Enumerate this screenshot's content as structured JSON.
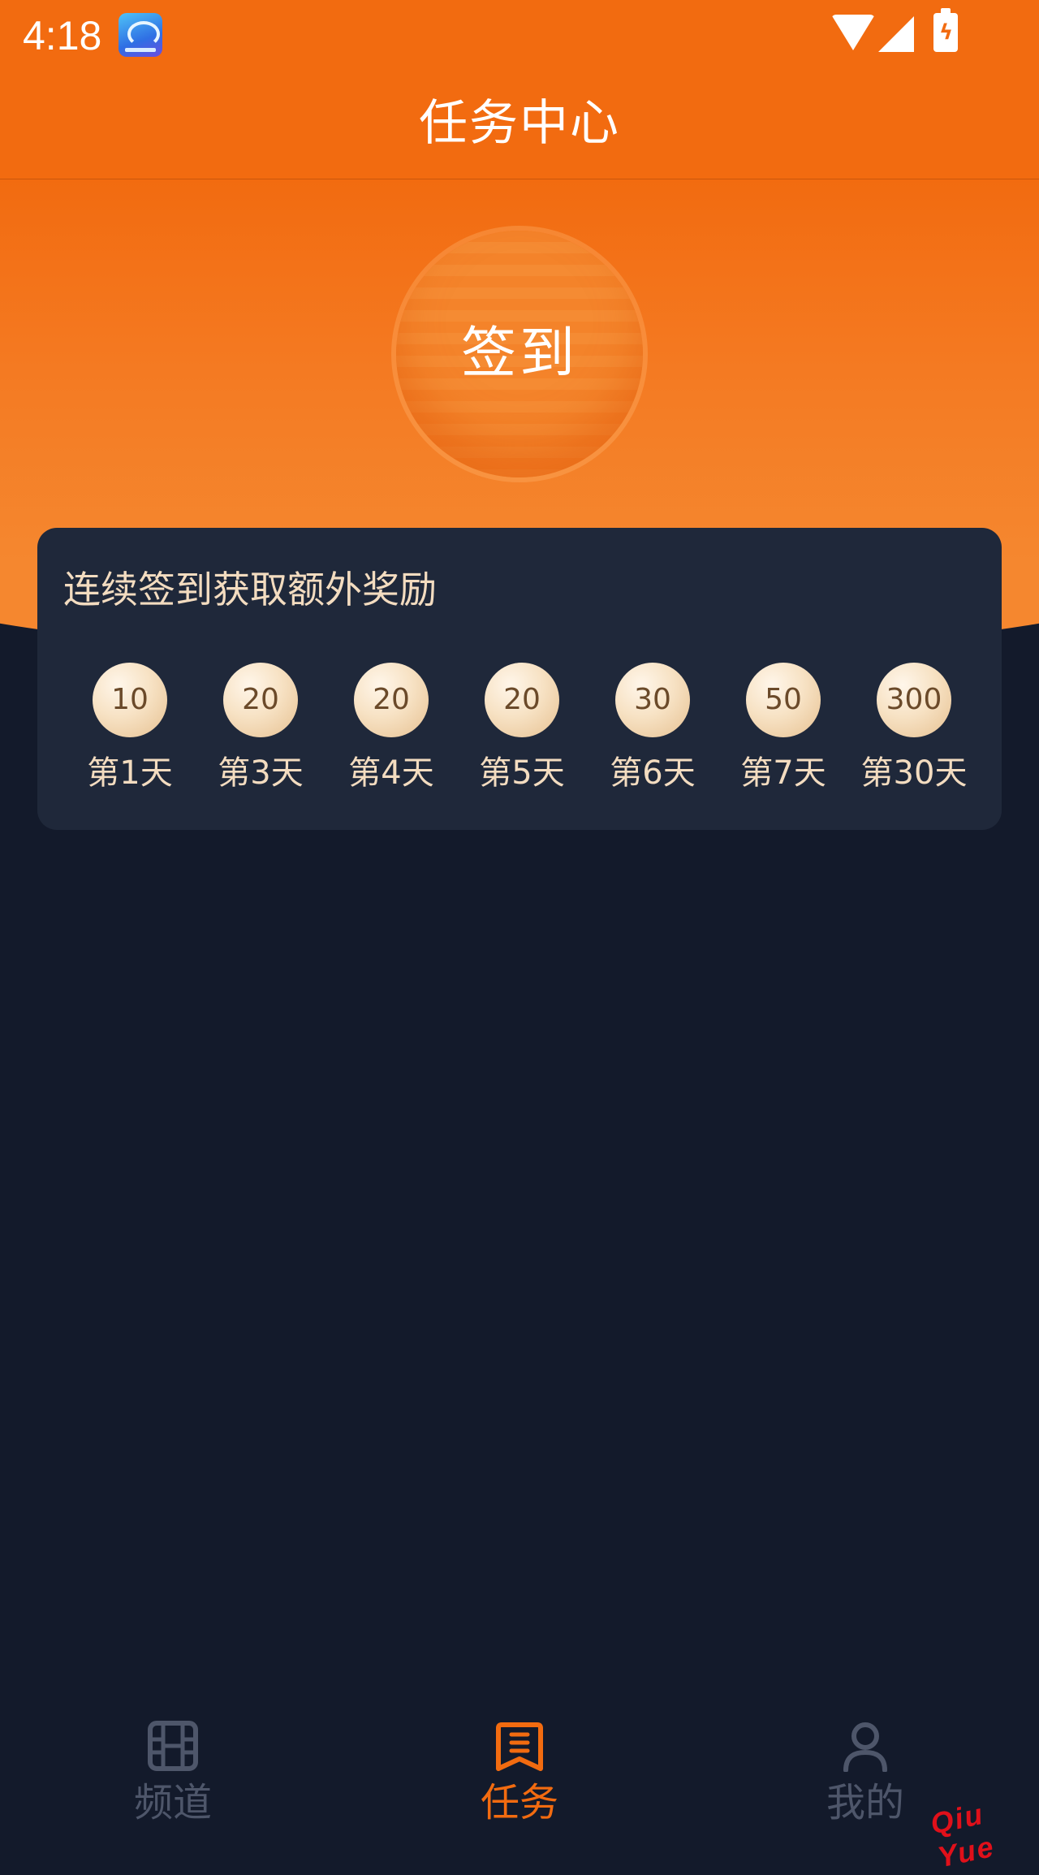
{
  "status_bar": {
    "time": "4:18"
  },
  "header": {
    "title": "任务中心"
  },
  "sign_in": {
    "label": "签到"
  },
  "rewards": {
    "title": "连续签到获取额外奖励",
    "items": [
      {
        "points": "10",
        "day": "第1天"
      },
      {
        "points": "20",
        "day": "第3天"
      },
      {
        "points": "20",
        "day": "第4天"
      },
      {
        "points": "20",
        "day": "第5天"
      },
      {
        "points": "30",
        "day": "第6天"
      },
      {
        "points": "50",
        "day": "第7天"
      },
      {
        "points": "300",
        "day": "第30天"
      }
    ]
  },
  "bottom_nav": {
    "items": [
      {
        "label": "频道",
        "icon": "film-icon",
        "active": false
      },
      {
        "label": "任务",
        "icon": "task-list-icon",
        "active": true
      },
      {
        "label": "我的",
        "icon": "person-icon",
        "active": false
      }
    ]
  },
  "watermark": "Qiu Yue",
  "colors": {
    "accent": "#f26b10",
    "background": "#131a2b",
    "card": "#1f283a",
    "gold_text": "#f3dcc0",
    "inactive_nav": "#4e566a"
  }
}
